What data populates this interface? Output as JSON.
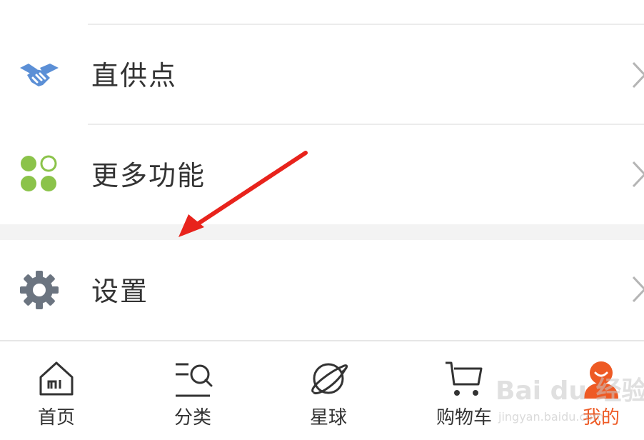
{
  "menu": {
    "items": [
      {
        "label": "直供点",
        "icon": "handshake-icon",
        "icon_color": "#5b8fd6"
      },
      {
        "label": "更多功能",
        "icon": "apps-grid-icon",
        "icon_color": "#8bc34a"
      },
      {
        "label": "设置",
        "icon": "gear-icon",
        "icon_color": "#6b7480"
      }
    ]
  },
  "tabbar": {
    "tabs": [
      {
        "label": "首页",
        "icon": "home-icon",
        "active": false
      },
      {
        "label": "分类",
        "icon": "category-search-icon",
        "active": false
      },
      {
        "label": "星球",
        "icon": "planet-icon",
        "active": false
      },
      {
        "label": "购物车",
        "icon": "cart-icon",
        "active": false
      },
      {
        "label": "我的",
        "icon": "profile-icon",
        "active": true
      }
    ],
    "active_color": "#ee5a24"
  },
  "annotation": {
    "arrow_color": "#e8231c"
  },
  "watermark": {
    "main": "Bai du 经验",
    "sub": "jingyan.baidu.com"
  }
}
